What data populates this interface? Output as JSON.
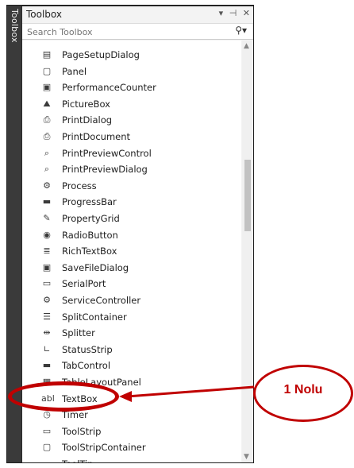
{
  "side_tab": "Toolbox",
  "panel": {
    "title": "Toolbox",
    "buttons": [
      "▾",
      "⊣",
      "✕"
    ]
  },
  "search": {
    "placeholder": "Search Toolbox"
  },
  "items": [
    {
      "label": "PageSetupDialog",
      "icon": "page-setup-dialog-icon",
      "glyph": "▤"
    },
    {
      "label": "Panel",
      "icon": "panel-icon",
      "glyph": "▢"
    },
    {
      "label": "PerformanceCounter",
      "icon": "performance-counter-icon",
      "glyph": "▣"
    },
    {
      "label": "PictureBox",
      "icon": "picture-box-icon",
      "glyph": "⛰"
    },
    {
      "label": "PrintDialog",
      "icon": "printer-icon",
      "glyph": "⎙"
    },
    {
      "label": "PrintDocument",
      "icon": "print-document-icon",
      "glyph": "⎙"
    },
    {
      "label": "PrintPreviewControl",
      "icon": "print-preview-control-icon",
      "glyph": "⌕"
    },
    {
      "label": "PrintPreviewDialog",
      "icon": "print-preview-dialog-icon",
      "glyph": "⌕"
    },
    {
      "label": "Process",
      "icon": "gear-icon",
      "glyph": "⚙"
    },
    {
      "label": "ProgressBar",
      "icon": "progress-bar-icon",
      "glyph": "▬"
    },
    {
      "label": "PropertyGrid",
      "icon": "wrench-icon",
      "glyph": "✎"
    },
    {
      "label": "RadioButton",
      "icon": "radio-button-icon",
      "glyph": "◉"
    },
    {
      "label": "RichTextBox",
      "icon": "rich-text-box-icon",
      "glyph": "≣"
    },
    {
      "label": "SaveFileDialog",
      "icon": "save-file-dialog-icon",
      "glyph": "▣"
    },
    {
      "label": "SerialPort",
      "icon": "serial-port-icon",
      "glyph": "▭"
    },
    {
      "label": "ServiceController",
      "icon": "service-controller-icon",
      "glyph": "⚙"
    },
    {
      "label": "SplitContainer",
      "icon": "split-container-icon",
      "glyph": "☰"
    },
    {
      "label": "Splitter",
      "icon": "splitter-icon",
      "glyph": "⇹"
    },
    {
      "label": "StatusStrip",
      "icon": "status-strip-icon",
      "glyph": "∟"
    },
    {
      "label": "TabControl",
      "icon": "tab-control-icon",
      "glyph": "▬"
    },
    {
      "label": "TableLayoutPanel",
      "icon": "table-layout-panel-icon",
      "glyph": "▦"
    },
    {
      "label": "TextBox",
      "icon": "text-box-icon",
      "glyph": "abl"
    },
    {
      "label": "Timer",
      "icon": "timer-icon",
      "glyph": "◷"
    },
    {
      "label": "ToolStrip",
      "icon": "tool-strip-icon",
      "glyph": "▭"
    },
    {
      "label": "ToolStripContainer",
      "icon": "tool-strip-container-icon",
      "glyph": "▢"
    },
    {
      "label": "ToolTip",
      "icon": "tooltip-icon",
      "glyph": "▭"
    }
  ],
  "callout": {
    "text": "1 Nolu",
    "color": "#c00000"
  }
}
